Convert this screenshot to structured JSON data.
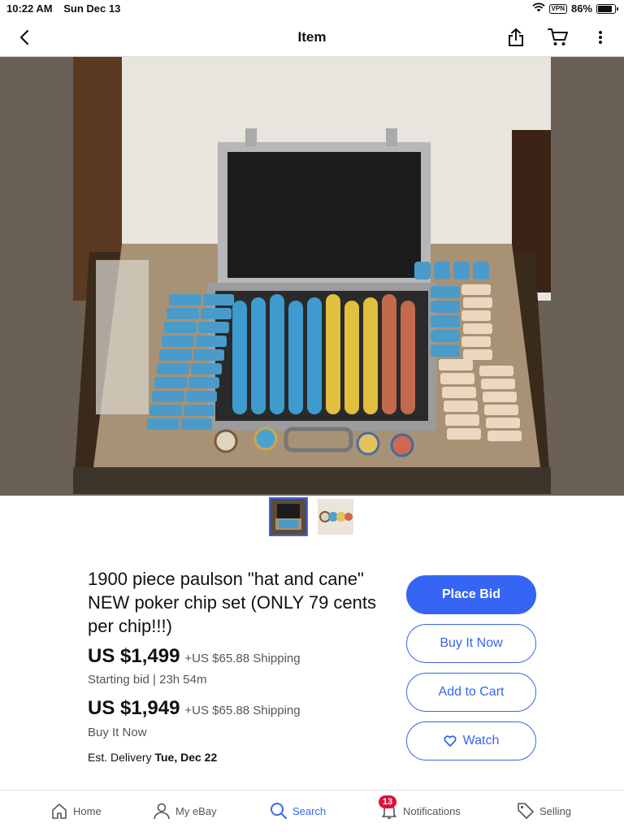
{
  "status_bar": {
    "time": "10:22 AM",
    "date": "Sun Dec 13",
    "vpn": "VPN",
    "battery": "86%",
    "battery_level": 0.86
  },
  "nav": {
    "title": "Item",
    "icons": [
      "chevron-left-icon",
      "share-icon",
      "cart-icon",
      "more-vertical-icon"
    ]
  },
  "gallery": {
    "thumbnail_count": 2,
    "active_index": 0
  },
  "item": {
    "title": "1900 piece paulson \"hat and cane\" NEW poker chip set (ONLY 79 cents per chip!!!)",
    "bid_price": "US $1,499",
    "bid_shipping": "+US $65.88 Shipping",
    "bid_info": "Starting bid | 23h 54m",
    "bin_price": "US $1,949",
    "bin_shipping": "+US $65.88 Shipping",
    "bin_info": "Buy It Now",
    "delivery_label": "Est. Delivery",
    "delivery_date": "Tue, Dec 22"
  },
  "actions": {
    "place_bid": "Place Bid",
    "buy_it_now": "Buy It Now",
    "add_to_cart": "Add to Cart",
    "watch": "Watch"
  },
  "tabs": {
    "home": "Home",
    "my_ebay": "My eBay",
    "search": "Search",
    "notifications": "Notifications",
    "notifications_badge": "13",
    "selling": "Selling"
  },
  "colors": {
    "accent": "#3665f3",
    "badge": "#e0103a"
  }
}
